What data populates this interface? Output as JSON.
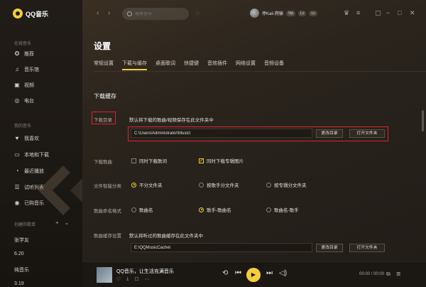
{
  "app": {
    "name": "QQ音乐"
  },
  "sidebar": {
    "online_title": "在线音乐",
    "online_items": [
      {
        "label": "推荐",
        "icon": "recommend-icon"
      },
      {
        "label": "音乐馆",
        "icon": "music-note-icon"
      },
      {
        "label": "视频",
        "icon": "video-icon"
      },
      {
        "label": "电台",
        "icon": "radio-icon"
      }
    ],
    "my_title": "我的音乐",
    "my_items": [
      {
        "label": "我喜欢",
        "icon": "heart-icon"
      },
      {
        "label": "本地和下载",
        "icon": "computer-icon"
      },
      {
        "label": "最近播放",
        "icon": "clock-icon"
      },
      {
        "label": "试听列表",
        "icon": "list-icon"
      },
      {
        "label": "已购音乐",
        "icon": "purchased-icon"
      }
    ],
    "created_title": "创建的歌单",
    "playlists": [
      "张学友",
      "6.20",
      "纯音乐",
      "3.19"
    ]
  },
  "topbar": {
    "search_placeholder": "搜索音乐",
    "username": "停Kali·爬输",
    "badge1": "Vip",
    "badge2": "Lv",
    "badge3": "Lv"
  },
  "page": {
    "title": "设置",
    "tabs": [
      "常规设置",
      "下载与缓存",
      "桌面歌词",
      "快捷键",
      "音效插件",
      "网络设置",
      "音频设备"
    ],
    "active_tab_index": 1
  },
  "download": {
    "section_title": "下载缓存",
    "dir_label": "下载目录",
    "dir_desc": "默认将下载的歌曲/视频保存在此文件夹中",
    "dir_path": "C:\\Users\\Administrator\\Music\\",
    "change_dir_button": "更改目录",
    "open_folder_button": "打开文件夹",
    "song_label": "下载歌曲",
    "opt_lyrics": "同时下载歌词",
    "opt_lyrics_checked": false,
    "opt_cover": "同时下载专辑图片",
    "opt_cover_checked": true,
    "classify_label": "文件智能分类",
    "classify_opts": [
      "不分文件夹",
      "按歌手分文件夹",
      "按专辑分文件夹"
    ],
    "classify_selected": 0,
    "naming_label": "歌曲命名格式",
    "naming_opts": [
      "歌曲名",
      "歌手-歌曲名",
      "歌曲名-歌手"
    ],
    "naming_selected": 1,
    "cache_label": "歌曲缓存设置",
    "cache_desc": "默认将听过的歌曲缓存在此文件夹中",
    "cache_path": "E:\\QQMusicCache\\",
    "cache_change_button": "更改目录",
    "cache_open_button": "打开文件夹"
  },
  "player": {
    "song_title": "QQ音乐，让生活充满音乐",
    "time": "00:00 / 00:00"
  },
  "colors": {
    "accent": "#f4cf3b",
    "highlight": "#e0222a"
  }
}
